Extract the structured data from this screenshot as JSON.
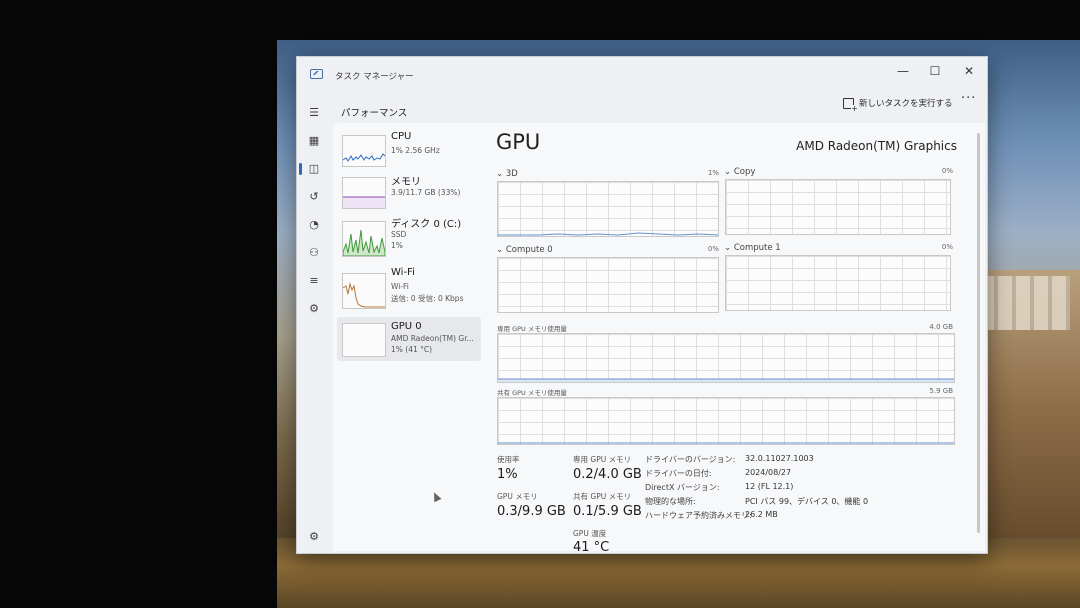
{
  "window": {
    "title": "タスク マネージャー",
    "controls": {
      "minimize": "—",
      "maximize": "☐",
      "close": "✕"
    }
  },
  "header": {
    "page_title": "パフォーマンス",
    "new_task_label": "新しいタスクを実行する",
    "more_label": "···"
  },
  "nav_icons": [
    "hamburger-icon",
    "processes-icon",
    "performance-icon",
    "app-history-icon",
    "startup-apps-icon",
    "users-icon",
    "details-icon",
    "services-icon",
    "settings-icon"
  ],
  "devices": [
    {
      "name": "CPU",
      "sub1": "1%  2.56 GHz",
      "sub2": ""
    },
    {
      "name": "メモリ",
      "sub1": "3.9/11.7 GB (33%)",
      "sub2": ""
    },
    {
      "name": "ディスク 0 (C:)",
      "sub1": "SSD",
      "sub2": "1%"
    },
    {
      "name": "Wi-Fi",
      "sub1": "Wi-Fi",
      "sub2": "送信: 0  受信: 0 Kbps"
    },
    {
      "name": "GPU 0",
      "sub1": "AMD Radeon(TM) Gr...",
      "sub2": "1%  (41 °C)"
    }
  ],
  "detail": {
    "title": "GPU",
    "model": "AMD Radeon(TM) Graphics",
    "engines": [
      {
        "label": "3D",
        "pct": "1%"
      },
      {
        "label": "Copy",
        "pct": "0%"
      },
      {
        "label": "Compute 0",
        "pct": "0%"
      },
      {
        "label": "Compute 1",
        "pct": "0%"
      }
    ],
    "dedicated_mem": {
      "label": "専用 GPU メモリ使用量",
      "max": "4.0 GB"
    },
    "shared_mem": {
      "label": "共有 GPU メモリ使用量",
      "max": "5.9 GB"
    },
    "stats": {
      "usage_label": "使用率",
      "usage_value": "1%",
      "dedicated_label": "専用 GPU メモリ",
      "dedicated_value": "0.2/4.0 GB",
      "gpu_mem_label": "GPU メモリ",
      "gpu_mem_value": "0.3/9.9 GB",
      "shared_label": "共有 GPU メモリ",
      "shared_value": "0.1/5.9 GB",
      "temp_label": "GPU 温度",
      "temp_value": "41 °C"
    },
    "properties": [
      {
        "key": "ドライバーのバージョン:",
        "value": "32.0.11027.1003"
      },
      {
        "key": "ドライバーの日付:",
        "value": "2024/08/27"
      },
      {
        "key": "DirectX バージョン:",
        "value": "12 (FL 12.1)"
      },
      {
        "key": "物理的な場所:",
        "value": "PCI バス 99、デバイス 0、機能 0"
      },
      {
        "key": "ハードウェア予約済みメモリ:",
        "value": "26.2 MB"
      }
    ]
  },
  "colors": {
    "accent": "#3466b5",
    "cpu_line": "#2f6fc0",
    "memory_line": "#8a4fb5",
    "disk_line": "#3f9a3a",
    "wifi_line": "#b5773a"
  }
}
